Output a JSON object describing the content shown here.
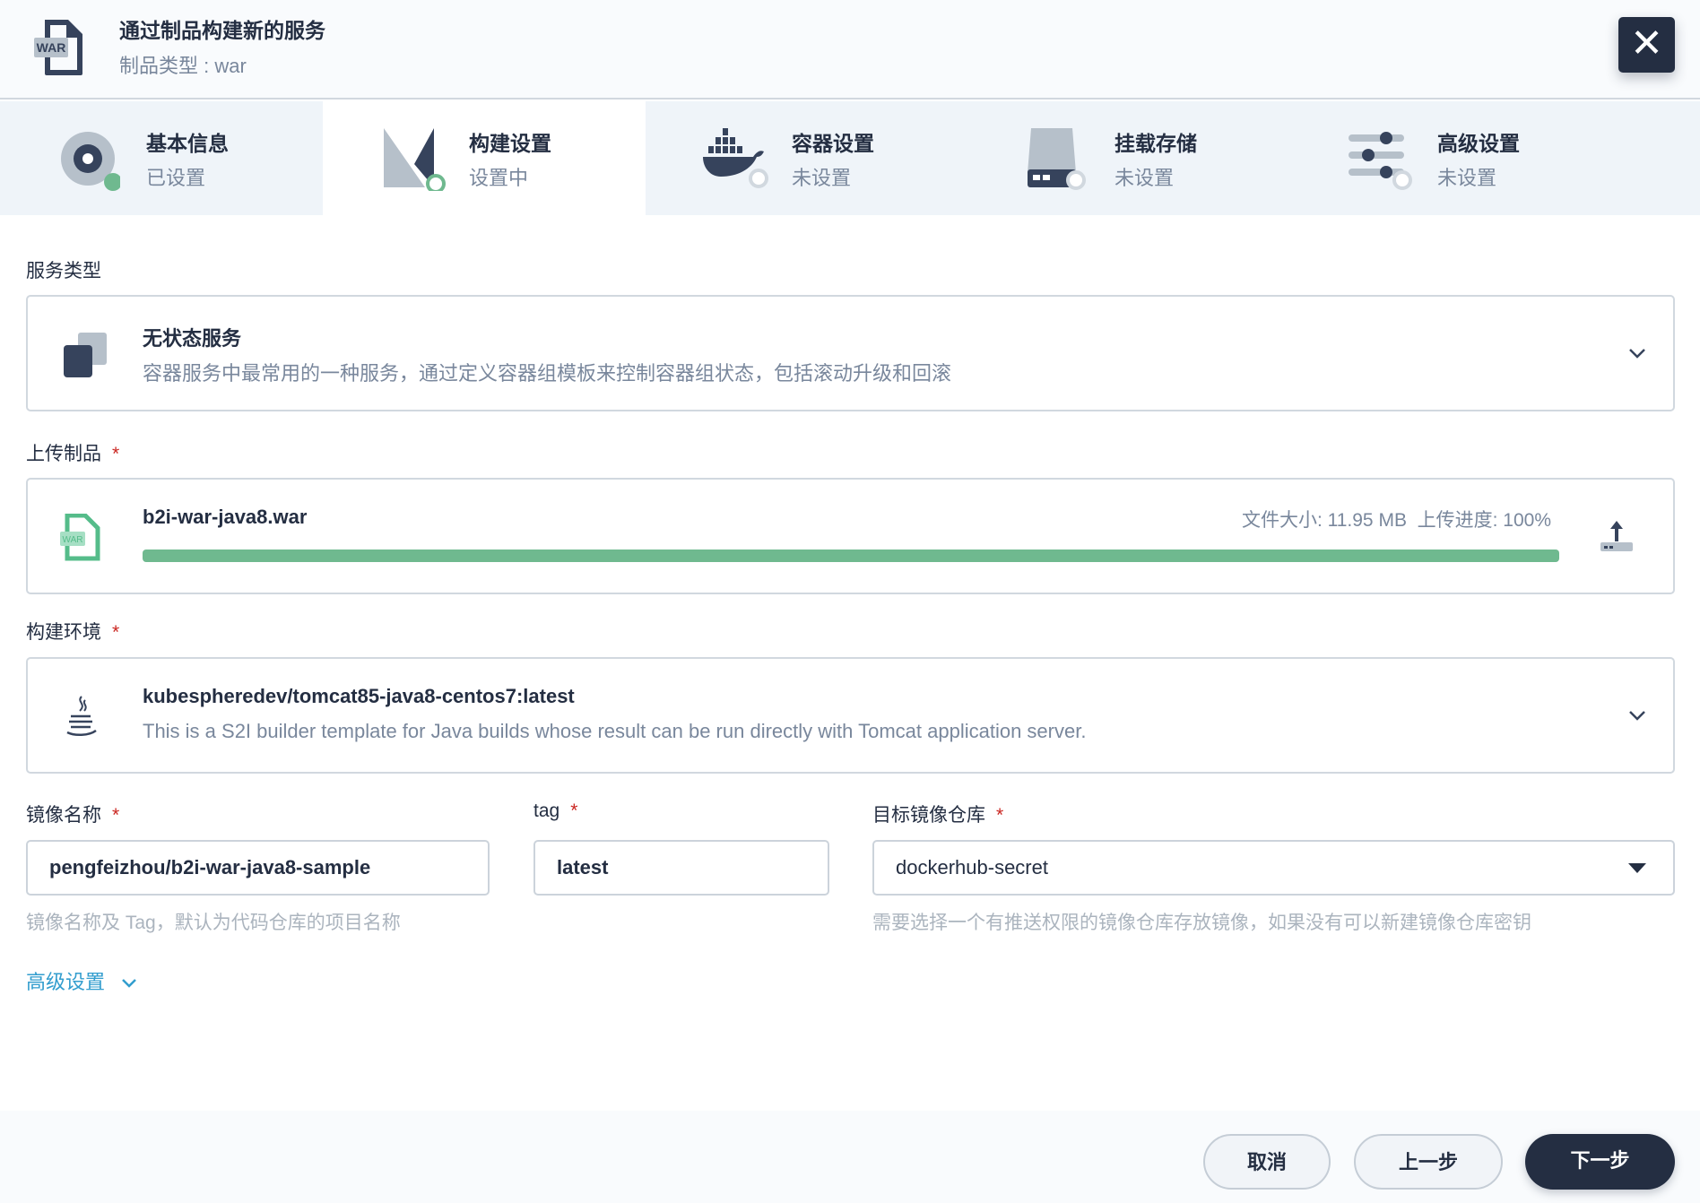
{
  "header": {
    "title": "通过制品构建新的服务",
    "subtitle": "制品类型 : war",
    "icon_text": "WAR",
    "close_icon": "close-icon"
  },
  "steps": [
    {
      "title": "基本信息",
      "status": "已设置"
    },
    {
      "title": "构建设置",
      "status": "设置中"
    },
    {
      "title": "容器设置",
      "status": "未设置"
    },
    {
      "title": "挂载存储",
      "status": "未设置"
    },
    {
      "title": "高级设置",
      "status": "未设置"
    }
  ],
  "service_type": {
    "label": "服务类型",
    "title": "无状态服务",
    "description": "容器服务中最常用的一种服务，通过定义容器组模板来控制容器组状态，包括滚动升级和回滚"
  },
  "upload": {
    "label": "上传制品",
    "required": "*",
    "file_name": "b2i-war-java8.war",
    "file_info": "文件大小: 11.95 MB  上传进度: 100%",
    "progress_percent": 100,
    "icon_text": "WAR"
  },
  "build_env": {
    "label": "构建环境",
    "required": "*",
    "title": "kubespheredev/tomcat85-java8-centos7:latest",
    "description": "This is a S2I builder template for Java builds whose result can be run directly with Tomcat application server."
  },
  "image_name": {
    "label": "镜像名称",
    "required": "*",
    "value": "pengfeizhou/b2i-war-java8-sample",
    "help": "镜像名称及 Tag，默认为代码仓库的项目名称"
  },
  "tag": {
    "label": "tag",
    "required": "*",
    "value": "latest"
  },
  "registry": {
    "label": "目标镜像仓库",
    "required": "*",
    "value": "dockerhub-secret",
    "help": "需要选择一个有推送权限的镜像仓库存放镜像，如果没有可以新建镜像仓库密钥"
  },
  "advanced_link": "高级设置",
  "footer": {
    "cancel": "取消",
    "prev": "上一步",
    "next": "下一步"
  },
  "colors": {
    "primary": "#242e42",
    "success": "#6fb98f",
    "link": "#329dce",
    "required": "#ca2621"
  }
}
